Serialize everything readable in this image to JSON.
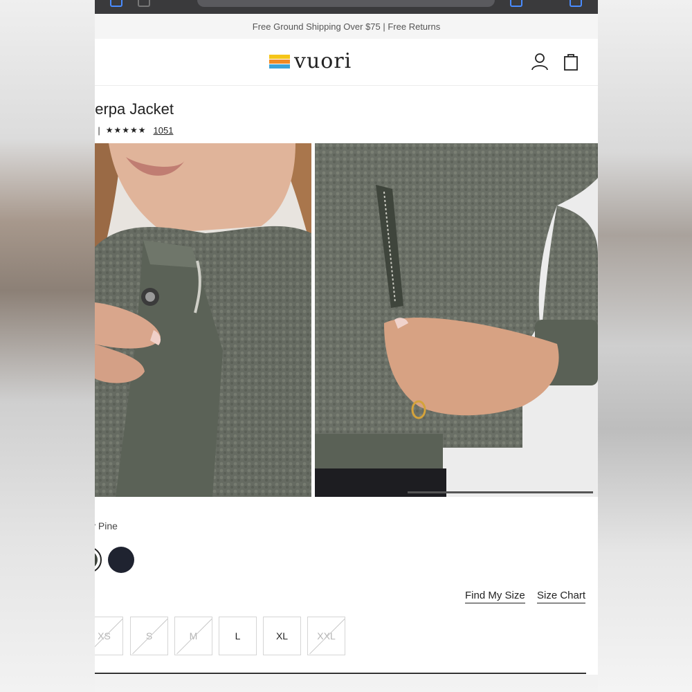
{
  "promo": {
    "text": "Free Ground Shipping Over $75 | Free Returns"
  },
  "header": {
    "logo_text": "vuori"
  },
  "product": {
    "title_fragment": "herpa Jacket",
    "price_fragment": ")",
    "separator": "|",
    "stars": "★★★★★",
    "review_count": "1051"
  },
  "color": {
    "label_fragment": "y Pine",
    "swatches": [
      "selected-olive",
      "navy"
    ]
  },
  "size": {
    "find_my_size": "Find My Size",
    "size_chart": "Size Chart",
    "options": [
      {
        "label": "XS",
        "available": false
      },
      {
        "label": "S",
        "available": false
      },
      {
        "label": "M",
        "available": false
      },
      {
        "label": "L",
        "available": true
      },
      {
        "label": "XL",
        "available": true
      },
      {
        "label": "XXL",
        "available": false
      }
    ]
  },
  "colors": {
    "logo_yellow": "#f5c518",
    "logo_orange": "#f08a24",
    "logo_blue": "#3aa3d8",
    "price_red": "#c0392b",
    "jacket_green": "#5d6458"
  }
}
